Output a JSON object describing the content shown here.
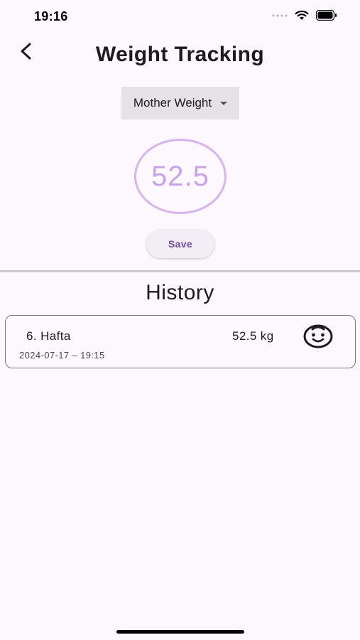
{
  "status_bar": {
    "time": "19:16",
    "icons": [
      "signal-dots-icon",
      "wifi-icon",
      "battery-icon"
    ]
  },
  "app_bar": {
    "back_icon": "chevron-left-icon",
    "title": "Weight Tracking"
  },
  "weight_type": {
    "selected": "Mother Weight"
  },
  "weight": {
    "value": "52.5"
  },
  "actions": {
    "save_label": "Save"
  },
  "history": {
    "title": "History",
    "entries": [
      {
        "week": "6. Hafta",
        "weight": "52.5 kg",
        "date": "2024-07-17 – 19:15",
        "icon": "baby-face-icon"
      }
    ]
  },
  "colors": {
    "background": "#fdf8fd",
    "accent": "#6f4aa8",
    "circle": "#d7b4ee",
    "weight_text": "#c9a3e8"
  }
}
